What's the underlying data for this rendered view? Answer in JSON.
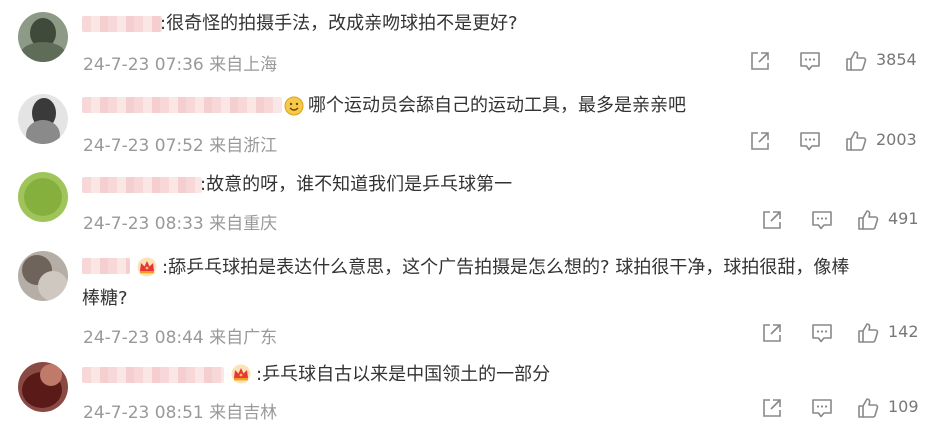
{
  "comments": [
    {
      "text": ":很奇怪的拍摄手法，改成亲吻球拍不是更好?",
      "date": "24-7-23 07:36",
      "location": "来自上海",
      "likes": "3854",
      "avatar_color": "#4a5a48"
    },
    {
      "text": "哪个运动员会舔自己的运动工具，最多是亲亲吧",
      "date": "24-7-23 07:52",
      "location": "来自浙江",
      "likes": "2003",
      "avatar_color": "#5a5a5a",
      "emoji": "smiling-face-emoji"
    },
    {
      "text": ":故意的呀，谁不知道我们是乒乓球第一",
      "date": "24-7-23 08:33",
      "location": "来自重庆",
      "likes": "491",
      "avatar_color": "#8fb84a"
    },
    {
      "text_line1": ":舔乒乓球拍是表达什么意思，这个广告拍摄是怎么想的? 球拍很干净，球拍很甜，像棒",
      "text_line2": "棒糖?",
      "date": "24-7-23 08:44",
      "location": "来自广东",
      "likes": "142",
      "avatar_color": "#8a7f78",
      "badge": "crown-badge"
    },
    {
      "text": ":乒乓球自古以来是中国领土的一部分",
      "date": "24-7-23 08:51",
      "location": "来自吉林",
      "likes": "109",
      "avatar_color": "#6a2a28",
      "badge": "crown-badge"
    }
  ],
  "icons": {
    "share": "share-icon",
    "comment": "comment-icon",
    "like": "thumbs-up-icon"
  }
}
